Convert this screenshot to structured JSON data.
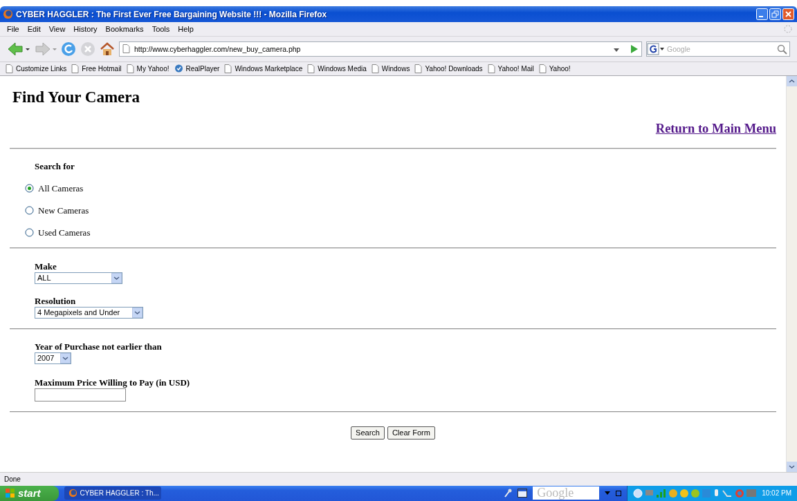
{
  "window": {
    "title": "CYBER HAGGLER : The First Ever Free Bargaining Website !!! - Mozilla Firefox"
  },
  "menu": [
    "File",
    "Edit",
    "View",
    "History",
    "Bookmarks",
    "Tools",
    "Help"
  ],
  "address_bar": {
    "url": "http://www.cyberhaggler.com/new_buy_camera.php"
  },
  "search_box": {
    "placeholder": "Google"
  },
  "bookmarks": [
    {
      "label": "Customize Links",
      "kind": "page"
    },
    {
      "label": "Free Hotmail",
      "kind": "page"
    },
    {
      "label": "My Yahoo!",
      "kind": "page"
    },
    {
      "label": "RealPlayer",
      "kind": "realplayer"
    },
    {
      "label": "Windows Marketplace",
      "kind": "page"
    },
    {
      "label": "Windows Media",
      "kind": "page"
    },
    {
      "label": "Windows",
      "kind": "page"
    },
    {
      "label": "Yahoo! Downloads",
      "kind": "page"
    },
    {
      "label": "Yahoo! Mail",
      "kind": "page"
    },
    {
      "label": "Yahoo!",
      "kind": "page"
    }
  ],
  "page": {
    "heading": "Find Your Camera",
    "return_link": "Return to Main Menu",
    "search_for": {
      "label": "Search for",
      "options": [
        {
          "label": "All Cameras",
          "selected": true
        },
        {
          "label": "New Cameras",
          "selected": false
        },
        {
          "label": "Used Cameras",
          "selected": false
        }
      ]
    },
    "make": {
      "label": "Make",
      "value": "ALL"
    },
    "resolution": {
      "label": "Resolution",
      "value": "4 Megapixels and Under"
    },
    "year": {
      "label": "Year of Purchase not earlier than",
      "value": "2007"
    },
    "max_price": {
      "label": "Maximum Price Willing to Pay (in USD)"
    },
    "buttons": [
      "Search",
      "Clear Form"
    ]
  },
  "status_bar": "Done",
  "taskbar": {
    "start": "start",
    "task": "CYBER HAGGLER : Th...",
    "search": "Google",
    "clock": "10:02 PM"
  }
}
